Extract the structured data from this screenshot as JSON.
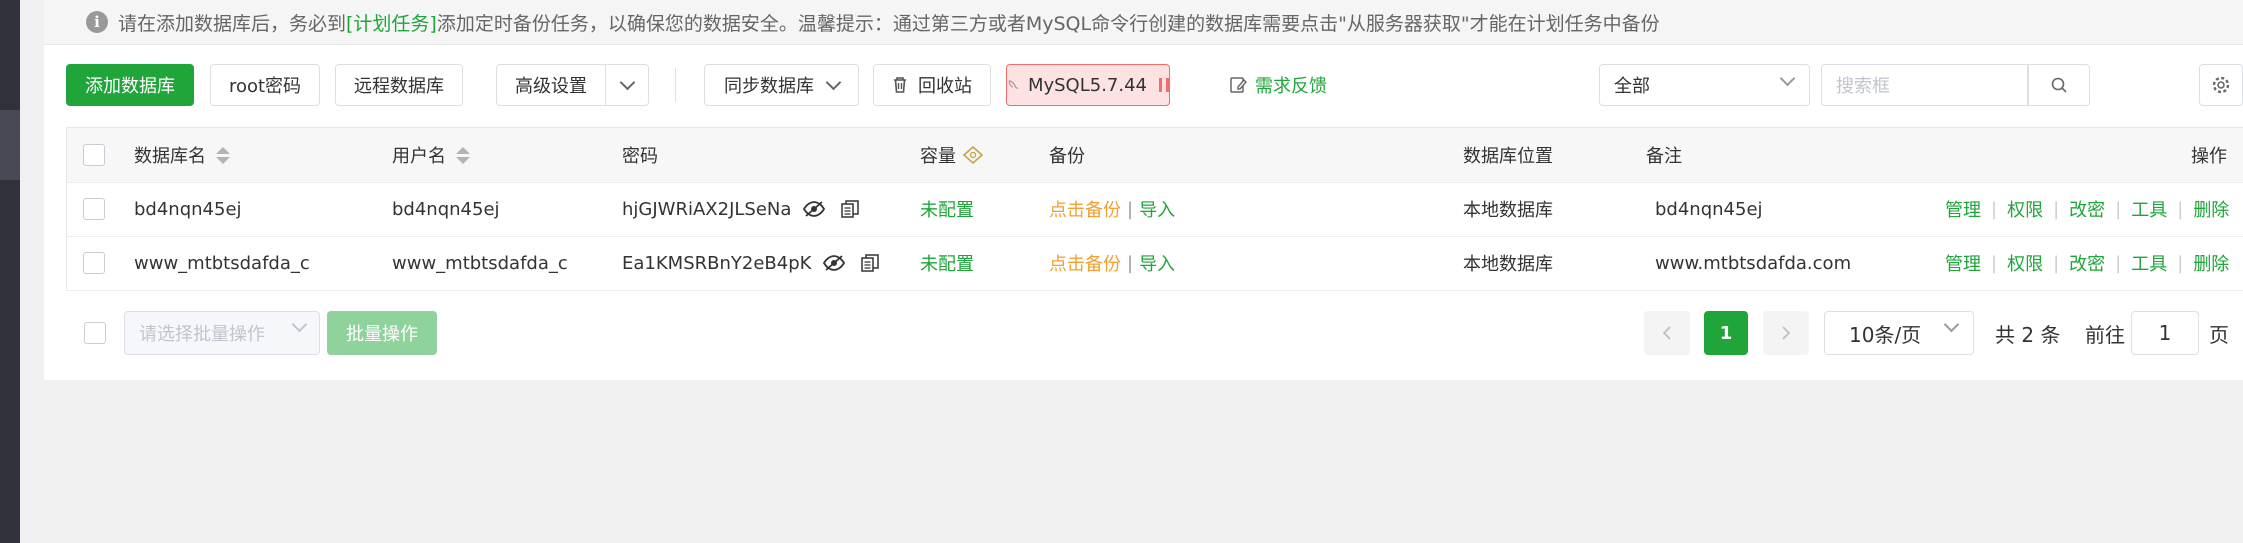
{
  "notice": {
    "text_before": "请在添加数据库后，务必到",
    "link": "[计划任务]",
    "text_after": "添加定时备份任务，以确保您的数据安全。温馨提示：通过第三方或者MySQL命令行创建的数据库需要点击\"从服务器获取\"才能在计划任务中备份"
  },
  "toolbar": {
    "add_db": "添加数据库",
    "root_pwd": "root密码",
    "remote_db": "远程数据库",
    "advanced": "高级设置",
    "sync_db": "同步数据库",
    "recycle": "回收站",
    "mysql_version": "MySQL5.7.44",
    "feedback": "需求反馈",
    "filter_value": "全部",
    "search_placeholder": "搜索框"
  },
  "table": {
    "headers": {
      "name": "数据库名",
      "user": "用户名",
      "password": "密码",
      "capacity": "容量",
      "backup": "备份",
      "location": "数据库位置",
      "remark": "备注",
      "actions": "操作"
    },
    "rows": [
      {
        "name": "bd4nqn45ej",
        "user": "bd4nqn45ej",
        "password": "hjGJWRiAX2JLSeNa",
        "capacity": "未配置",
        "backup_link": "点击备份",
        "import": "导入",
        "location": "本地数据库",
        "remark": "bd4nqn45ej"
      },
      {
        "name": "www_mtbtsdafda_c",
        "user": "www_mtbtsdafda_c",
        "password": "Ea1KMSRBnY2eB4pK",
        "capacity": "未配置",
        "backup_link": "点击备份",
        "import": "导入",
        "location": "本地数据库",
        "remark": "www.mtbtsdafda.com"
      }
    ],
    "actions": [
      "管理",
      "权限",
      "改密",
      "工具",
      "删除"
    ]
  },
  "footer": {
    "batch_placeholder": "请选择批量操作",
    "batch_button": "批量操作",
    "current_page": "1",
    "page_size": "10条/页",
    "total": "共 2 条",
    "goto_label": "前往",
    "goto_value": "1",
    "page_unit": "页"
  },
  "colors": {
    "brand_green": "#20a53a",
    "warning_orange": "#f0a030",
    "mysql_bg": "#fde2e2",
    "sidebar_dark": "#2f3238"
  },
  "icons": [
    "info-icon",
    "sort-icon",
    "eye-off-icon",
    "copy-icon",
    "trash-icon",
    "mysql-dolphin-icon",
    "pause-icon",
    "feedback-edit-icon",
    "search-icon",
    "gear-icon",
    "chevron-down-icon",
    "chevron-left-icon",
    "chevron-right-icon",
    "diamond-icon"
  ]
}
